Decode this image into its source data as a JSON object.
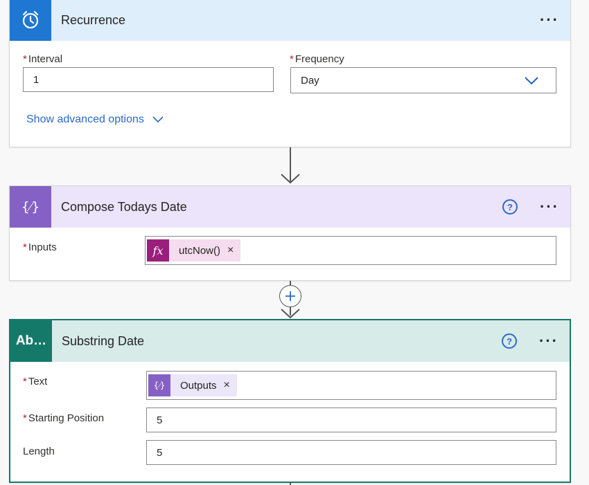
{
  "recurrence": {
    "title": "Recurrence",
    "more_icon": "more-dots-icon",
    "interval_label": "Interval",
    "interval_value": "1",
    "frequency_label": "Frequency",
    "frequency_value": "Day",
    "advanced_link": "Show advanced options",
    "header_color": "#deeefb",
    "icon_color": "#1e77d2"
  },
  "compose": {
    "title": "Compose Todays Date",
    "inputs_label": "Inputs",
    "token_label": "utcNow()",
    "token_icon_text": "fx",
    "header_color": "#ece4fb",
    "icon_color": "#8661c5",
    "token_bg": "#f5dcee",
    "token_icon_color": "#9a1f7d"
  },
  "substring": {
    "title": "Substring Date",
    "icon_text": "Ab…",
    "text_label": "Text",
    "text_token": "Outputs",
    "start_label": "Starting Position",
    "start_value": "5",
    "length_label": "Length",
    "length_value": "5",
    "header_color": "#d7ebe9",
    "icon_color": "#15796a",
    "token_bg": "#ebe6f8",
    "token_icon_color": "#8661c5"
  },
  "required_mark": "*"
}
